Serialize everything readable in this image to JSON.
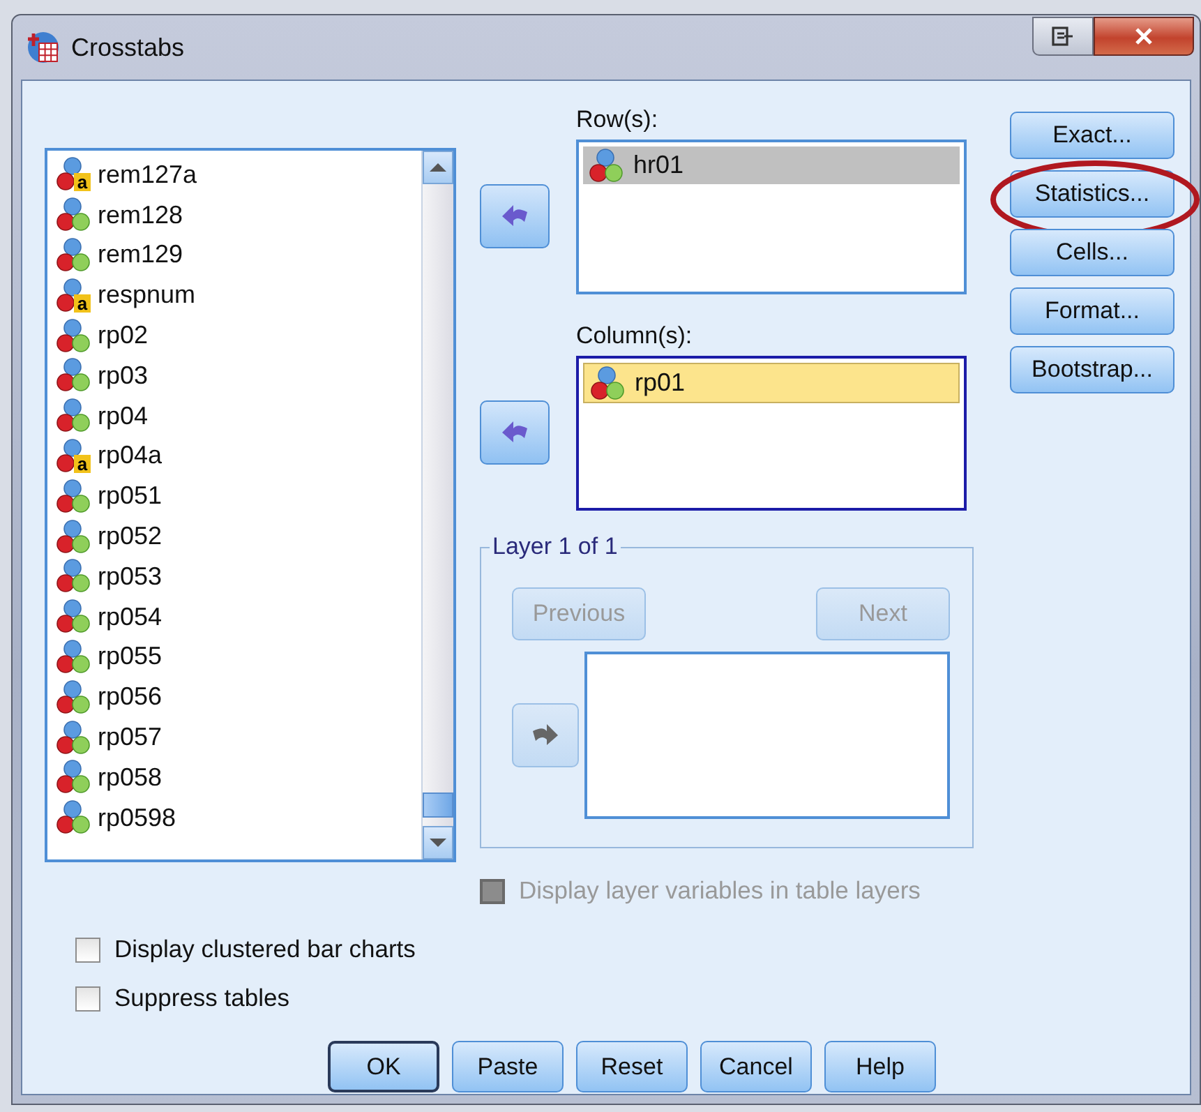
{
  "window": {
    "title": "Crosstabs"
  },
  "variables": {
    "items": [
      {
        "name": "rem127a",
        "kind": "string",
        "badge": "a"
      },
      {
        "name": "rem128",
        "kind": "scale"
      },
      {
        "name": "rem129",
        "kind": "scale"
      },
      {
        "name": "respnum",
        "kind": "string",
        "badge": "a"
      },
      {
        "name": "rp02",
        "kind": "scale"
      },
      {
        "name": "rp03",
        "kind": "scale"
      },
      {
        "name": "rp04",
        "kind": "scale"
      },
      {
        "name": "rp04a",
        "kind": "string",
        "badge": "a"
      },
      {
        "name": "rp051",
        "kind": "scale"
      },
      {
        "name": "rp052",
        "kind": "scale"
      },
      {
        "name": "rp053",
        "kind": "scale"
      },
      {
        "name": "rp054",
        "kind": "scale"
      },
      {
        "name": "rp055",
        "kind": "scale"
      },
      {
        "name": "rp056",
        "kind": "scale"
      },
      {
        "name": "rp057",
        "kind": "scale"
      },
      {
        "name": "rp058",
        "kind": "scale"
      },
      {
        "name": "rp0598",
        "kind": "scale"
      }
    ]
  },
  "rows": {
    "label": "Row(s):",
    "focused": false,
    "items": [
      {
        "name": "hr01",
        "kind": "scale",
        "selected": true
      }
    ]
  },
  "columns": {
    "label": "Column(s):",
    "focused": true,
    "items": [
      {
        "name": "rp01",
        "kind": "scale",
        "selected": true
      }
    ]
  },
  "layer": {
    "title": "Layer 1 of 1",
    "previous": {
      "label": "Previous",
      "disabled": true
    },
    "next": {
      "label": "Next",
      "disabled": true
    },
    "arrow_disabled": true
  },
  "display_layer": {
    "label": "Display layer variables in table layers",
    "checked": false,
    "disabled": true
  },
  "options": [
    {
      "label": "Display clustered bar charts",
      "checked": false
    },
    {
      "label": "Suppress tables",
      "checked": false
    }
  ],
  "side_buttons": [
    {
      "label": "Exact...",
      "circled": false
    },
    {
      "label": "Statistics...",
      "circled": true
    },
    {
      "label": "Cells...",
      "circled": false
    },
    {
      "label": "Format...",
      "circled": false
    },
    {
      "label": "Bootstrap...",
      "circled": false
    }
  ],
  "buttons": [
    {
      "label": "OK",
      "default": true
    },
    {
      "label": "Paste",
      "default": false
    },
    {
      "label": "Reset",
      "default": false
    },
    {
      "label": "Cancel",
      "default": false
    },
    {
      "label": "Help",
      "default": false
    }
  ]
}
